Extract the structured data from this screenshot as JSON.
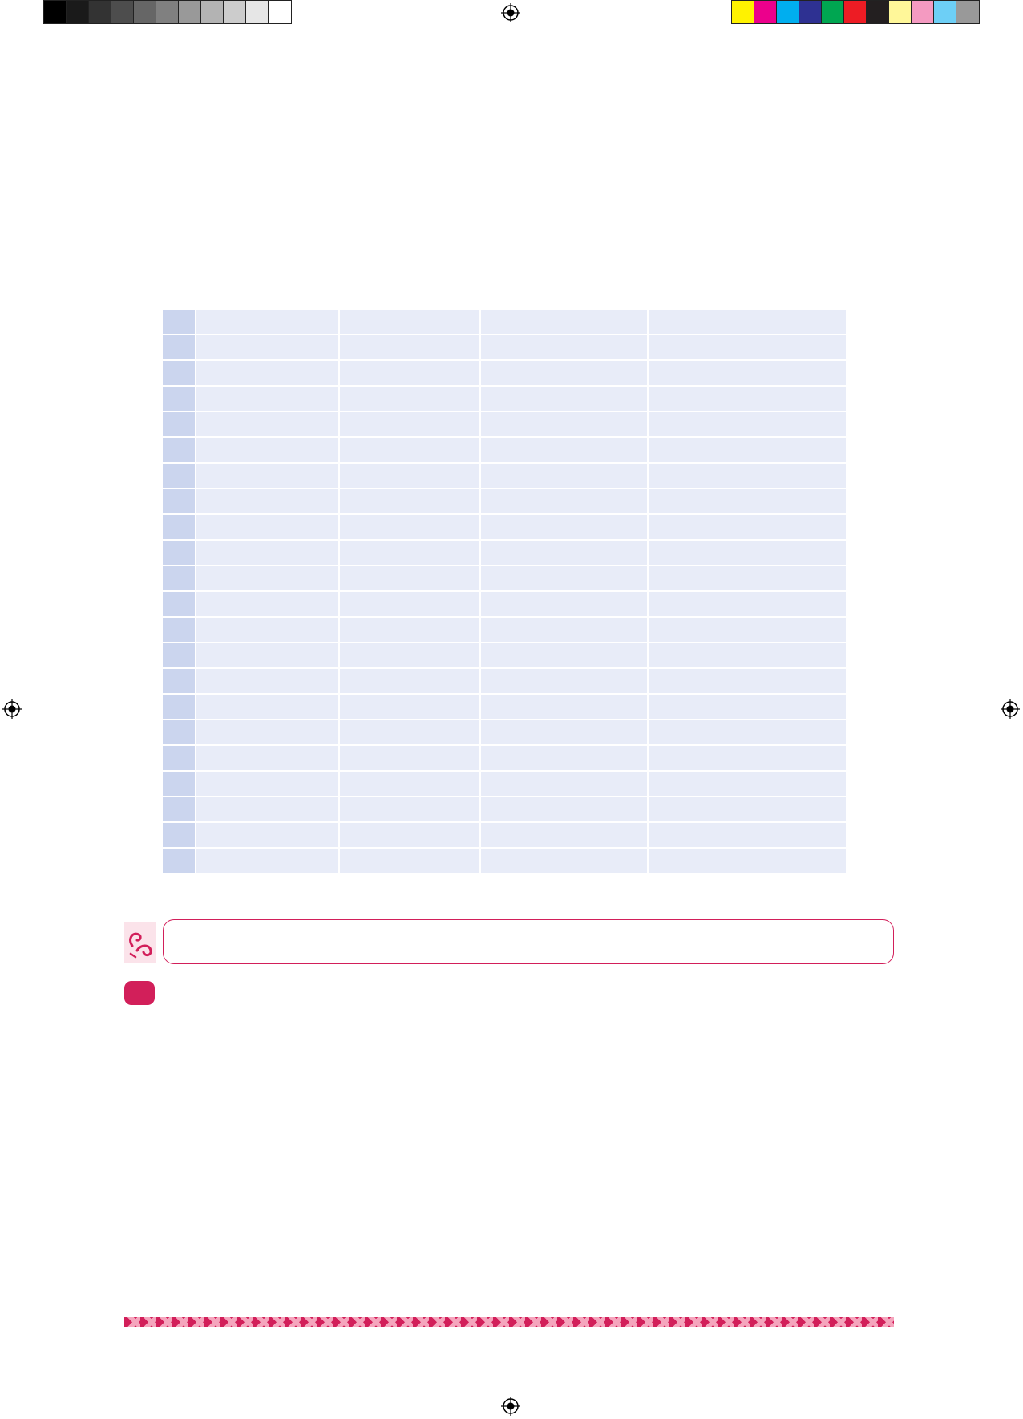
{
  "colors": {
    "accent": "#d21f5a",
    "table_cell": "#e8ecf8",
    "table_first_col": "#cbd5ee"
  },
  "grayscale_bar": [
    "#000000",
    "#1a1a1a",
    "#333333",
    "#4d4d4d",
    "#666666",
    "#808080",
    "#999999",
    "#b3b3b3",
    "#cccccc",
    "#e6e6e6",
    "#ffffff"
  ],
  "color_bar": [
    "#fff200",
    "#ec008c",
    "#00aeef",
    "#2e3192",
    "#00a651",
    "#ed1c24",
    "#231f20",
    "#fff799",
    "#f49ac1",
    "#6dcff6",
    "#999999"
  ],
  "table": {
    "rows": 22,
    "columns": 5
  },
  "icons": {
    "note": "curled-hand-icon",
    "registration": "registration-mark-icon"
  }
}
